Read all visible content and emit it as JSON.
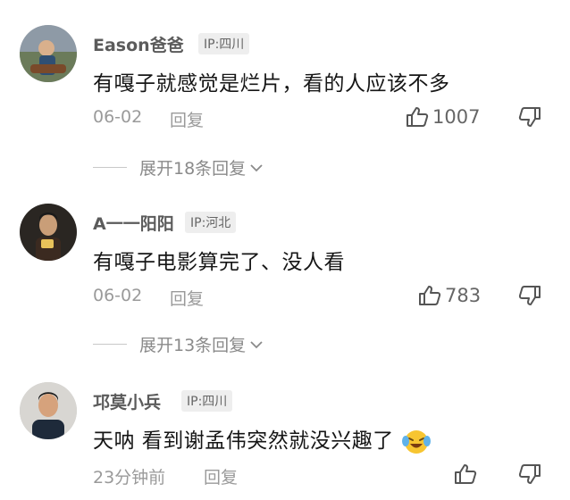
{
  "comments": [
    {
      "username": "Eason爸爸",
      "ip": "IP:四川",
      "content": "有嘎子就感觉是烂片，看的人应该不多",
      "date": "06-02",
      "reply_label": "回复",
      "likes": "1007",
      "expand_label": "展开18条回复"
    },
    {
      "username": "A一一阳阳",
      "ip": "IP:河北",
      "content": "有嘎子电影算完了、没人看",
      "date": "06-02",
      "reply_label": "回复",
      "likes": "783",
      "expand_label": "展开13条回复"
    },
    {
      "username": "邛莫小兵",
      "ip": "IP:四川",
      "content": "天呐 看到谢孟伟突然就没兴趣了",
      "emoji": "laughing-crying-emoji",
      "date": "23分钟前",
      "reply_label": "回复",
      "likes": ""
    }
  ],
  "colors": {
    "username": "#5b5b5b",
    "meta": "#9a9a9a",
    "content": "#161616",
    "badge_bg": "#eeeeee"
  }
}
